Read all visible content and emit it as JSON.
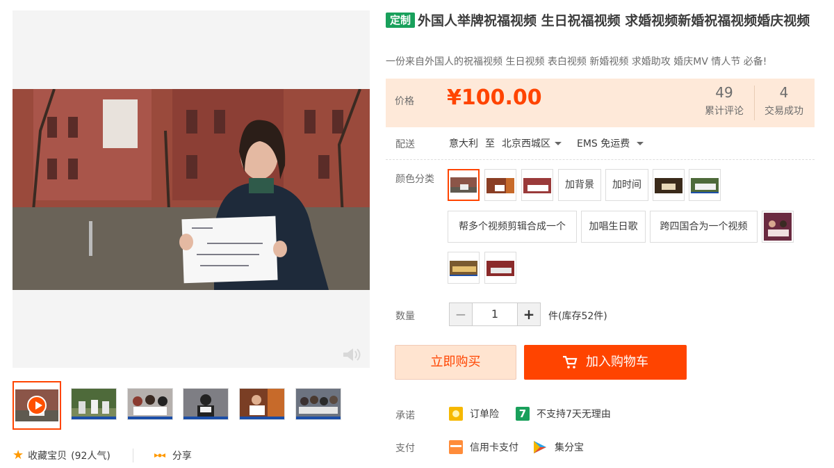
{
  "product": {
    "tag": "定制",
    "title": "外国人举牌祝福视频 生日祝福视频 求婚视频新婚祝福视频婚庆视频",
    "subtitle": "一份来自外国人的祝福视频 生日视频 表白视频 新婚视频 求婚助攻 婚庆MV 情人节 必备!"
  },
  "price": {
    "label": "价格",
    "value": "¥100.00",
    "reviews_count": "49",
    "reviews_label": "累计评论",
    "sales_count": "4",
    "sales_label": "交易成功"
  },
  "shipping": {
    "label": "配送",
    "from": "意大利",
    "to_word": "至",
    "destination": "北京西城区",
    "method": "EMS 免运费"
  },
  "sku": {
    "label": "颜色分类",
    "text_options": [
      "加背景",
      "加时间",
      "帮多个视频剪辑合成一个",
      "加唱生日歌",
      "跨四国合为一个视频"
    ]
  },
  "quantity": {
    "label": "数量",
    "value": "1",
    "minus": "−",
    "plus": "+",
    "stock": "件(库存52件)"
  },
  "actions": {
    "buy_now": "立即购买",
    "add_to_cart": "加入购物车"
  },
  "promise": {
    "label": "承诺",
    "item1": "订单险",
    "item2": "不支持7天无理由",
    "item2_icon_text": "7"
  },
  "payment": {
    "label": "支付",
    "item1": "信用卡支付",
    "item2": "集分宝"
  },
  "footer": {
    "favorite": "收藏宝贝",
    "popularity": "(92人气)",
    "share": "分享"
  },
  "colors": {
    "accent": "#ff4400",
    "tag_green": "#19a05b",
    "price_bg": "#fee9d9"
  }
}
